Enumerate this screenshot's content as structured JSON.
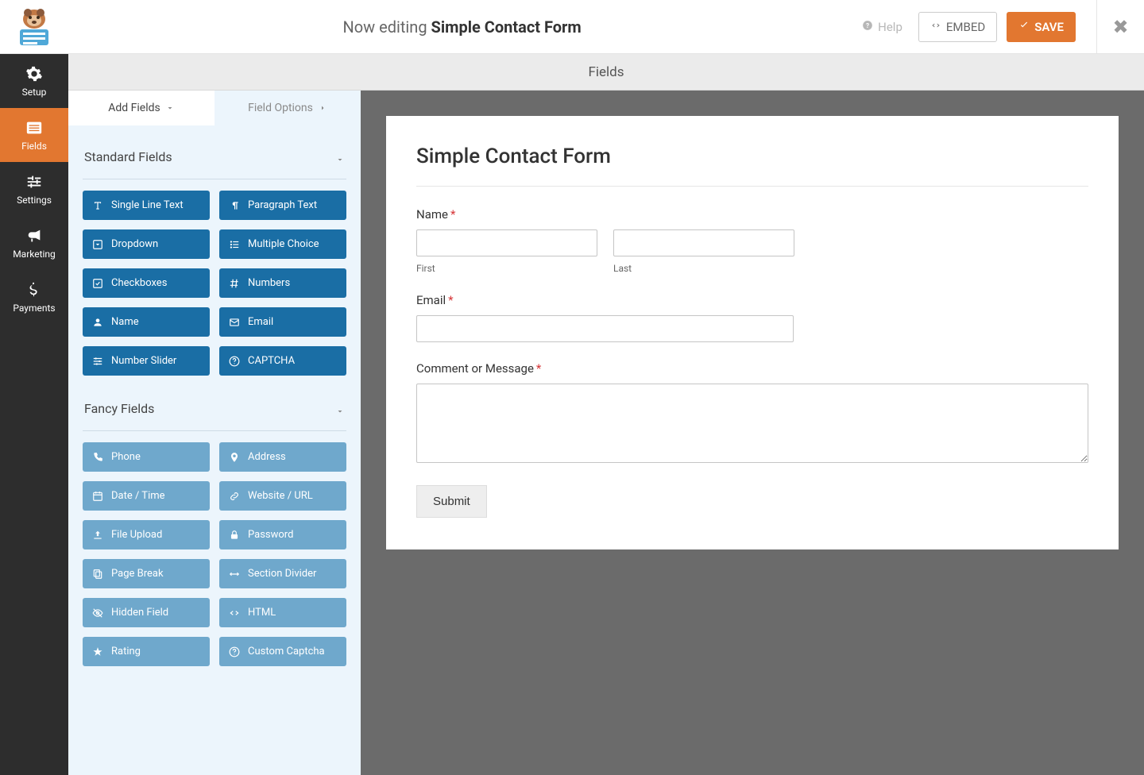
{
  "header": {
    "editing_prefix": "Now editing",
    "form_name": "Simple Contact Form",
    "help_label": "Help",
    "embed_label": "EMBED",
    "save_label": "SAVE"
  },
  "nav": {
    "setup": "Setup",
    "fields": "Fields",
    "settings": "Settings",
    "marketing": "Marketing",
    "payments": "Payments"
  },
  "section_title": "Fields",
  "panel_tabs": {
    "add_fields": "Add Fields",
    "field_options": "Field Options"
  },
  "groups": {
    "standard": {
      "title": "Standard Fields",
      "items": [
        {
          "label": "Single Line Text",
          "icon": "text"
        },
        {
          "label": "Paragraph Text",
          "icon": "paragraph"
        },
        {
          "label": "Dropdown",
          "icon": "caret-square"
        },
        {
          "label": "Multiple Choice",
          "icon": "list-ul"
        },
        {
          "label": "Checkboxes",
          "icon": "check-square"
        },
        {
          "label": "Numbers",
          "icon": "hash"
        },
        {
          "label": "Name",
          "icon": "user"
        },
        {
          "label": "Email",
          "icon": "envelope"
        },
        {
          "label": "Number Slider",
          "icon": "sliders"
        },
        {
          "label": "CAPTCHA",
          "icon": "question-circle"
        }
      ]
    },
    "fancy": {
      "title": "Fancy Fields",
      "items": [
        {
          "label": "Phone",
          "icon": "phone"
        },
        {
          "label": "Address",
          "icon": "map-marker"
        },
        {
          "label": "Date / Time",
          "icon": "calendar"
        },
        {
          "label": "Website / URL",
          "icon": "link"
        },
        {
          "label": "File Upload",
          "icon": "upload"
        },
        {
          "label": "Password",
          "icon": "lock"
        },
        {
          "label": "Page Break",
          "icon": "files"
        },
        {
          "label": "Section Divider",
          "icon": "arrows-h"
        },
        {
          "label": "Hidden Field",
          "icon": "eye-slash"
        },
        {
          "label": "HTML",
          "icon": "code"
        },
        {
          "label": "Rating",
          "icon": "star"
        },
        {
          "label": "Custom Captcha",
          "icon": "question-circle"
        }
      ]
    }
  },
  "preview": {
    "title": "Simple Contact Form",
    "name_label": "Name",
    "first_sub": "First",
    "last_sub": "Last",
    "email_label": "Email",
    "comment_label": "Comment or Message",
    "submit_label": "Submit"
  }
}
